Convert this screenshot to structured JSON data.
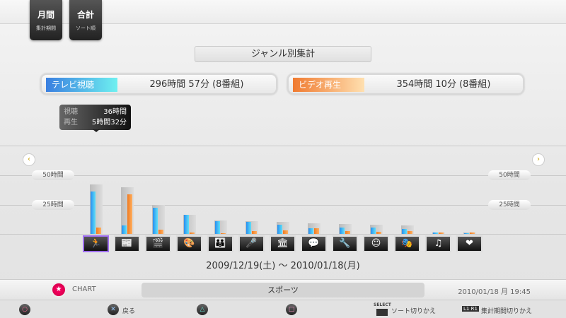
{
  "top_buttons": [
    {
      "main": "月間",
      "sub": "集計期間"
    },
    {
      "main": "合計",
      "sub": "ソート順"
    }
  ],
  "title": "ジャンル別集計",
  "tv": {
    "label": "テレビ視聴",
    "value": "296時間 57分 (8番組)"
  },
  "video": {
    "label": "ビデオ再生",
    "value": "354時間 10分 (8番組)"
  },
  "tooltip": {
    "watch_label": "視聴",
    "watch_value": "36時間",
    "play_label": "再生",
    "play_value": "5時間32分"
  },
  "y_labels": {
    "h50": "50時間",
    "h25": "25時間"
  },
  "colors": {
    "tv": "#2a8ff0",
    "video": "#f08a30",
    "total": "#c4c4c4"
  },
  "chart_data": {
    "type": "bar",
    "unit": "hours",
    "ylim": [
      0,
      75
    ],
    "categories": [
      "sports",
      "news",
      "movie",
      "anime",
      "family",
      "variety",
      "documentary",
      "hobby",
      "science",
      "kids",
      "theater",
      "music",
      "welfare"
    ],
    "series": [
      {
        "name": "テレビ視聴",
        "values": [
          36,
          7,
          22,
          16,
          11,
          10,
          8,
          5,
          5.5,
          5.5,
          4,
          1,
          0.5
        ]
      },
      {
        "name": "ビデオ再生",
        "values": [
          5.5,
          34,
          3.6,
          1,
          0.3,
          2.4,
          3,
          5,
          2.4,
          2,
          2.4,
          1,
          1
        ]
      },
      {
        "name": "total",
        "values": [
          42,
          40,
          25,
          16.5,
          11.5,
          11,
          10.5,
          9,
          8.5,
          8,
          7.5,
          1,
          1
        ]
      }
    ]
  },
  "genre_icons": [
    "🏃",
    "📰",
    "🎬",
    "🎨",
    "👪",
    "🎤",
    "🏛",
    "💬",
    "🔧",
    "☺",
    "🎭",
    "♫",
    "❤"
  ],
  "date_range": "2009/12/19(土) 〜 2010/01/18(月)",
  "status": {
    "app": "CHART",
    "genre": "スポーツ",
    "clock": "2010/01/18 月 19:45"
  },
  "footer": {
    "back": "戻る",
    "select": "SELECT",
    "sort": "ソート切りかえ",
    "l1r1": "L1 R1",
    "period": "集計期間切りかえ"
  }
}
